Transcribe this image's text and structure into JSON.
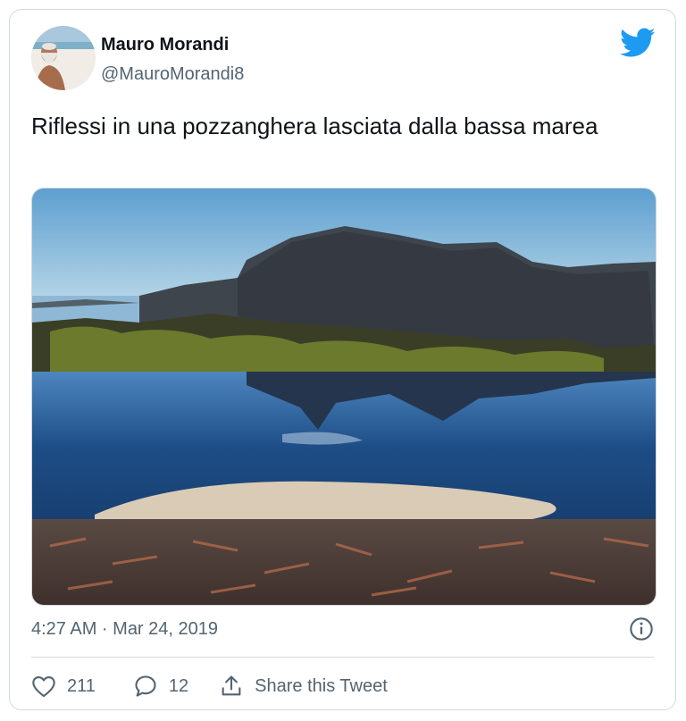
{
  "tweet": {
    "author_name": "Mauro Morandi",
    "author_handle": "@MauroMorandi8",
    "text": "Riflessi in una pozzanghera lasciata dalla bassa marea",
    "timestamp": "4:27 AM · Mar 24, 2019",
    "like_count": "211",
    "reply_count": "12",
    "share_label": "Share this Tweet"
  },
  "icons": {
    "brand": "twitter-bird-icon",
    "info": "info-icon",
    "like": "heart-icon",
    "reply": "speech-bubble-icon",
    "share": "share-upload-icon"
  },
  "colors": {
    "brand_blue": "#1d9bf0",
    "secondary_text": "#536471",
    "border": "#cfd9de"
  }
}
